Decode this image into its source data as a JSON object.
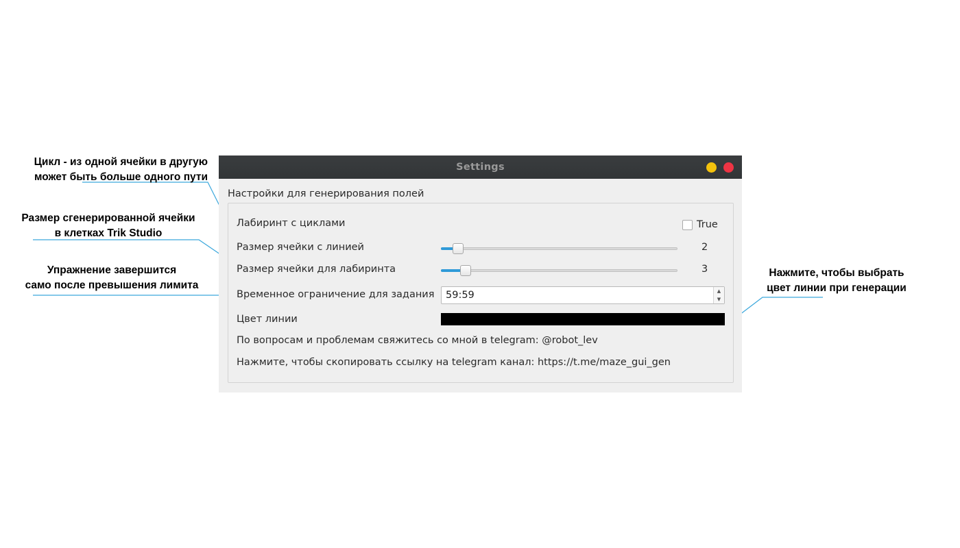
{
  "annotations": {
    "cycle": [
      "Цикл - из одной ячейки в другую",
      "может быть больше одного пути"
    ],
    "cell_size": [
      "Размер сгенерированной ячейки",
      "в клетках Trik Studio"
    ],
    "time_limit": [
      "Упражнение завершится",
      "само после превышения лимита"
    ],
    "color": [
      "Нажмите, чтобы выбрать",
      "цвет линии при генерации"
    ]
  },
  "window": {
    "title": "Settings",
    "colors": {
      "titlebar": "#3a3d3f",
      "minimize": "#f4c20d",
      "close": "#ee3444",
      "accent": "#2f9ad8",
      "leader_line": "#3aa7dc"
    }
  },
  "group": {
    "title": "Настройки для генерирования полей",
    "maze_cycles": {
      "label": "Лабиринт с циклами",
      "checkbox_label": "True",
      "checked": false
    },
    "line_cell_size": {
      "label": "Размер ячейки с линией",
      "value": "2",
      "level": 0.05
    },
    "maze_cell_size": {
      "label": "Размер ячейки для лабиринта",
      "value": "3",
      "level": 0.085
    },
    "time_limit": {
      "label": "Временное ограничение для задания",
      "value": "59:59"
    },
    "line_color": {
      "label": "Цвет линии",
      "value": "#000000"
    },
    "contact": "По вопросам и проблемам свяжитесь со мной в telegram: @robot_lev",
    "copy_link": "Нажмите, чтобы скопировать ссылку на telegram канал: https://t.me/maze_gui_gen"
  }
}
